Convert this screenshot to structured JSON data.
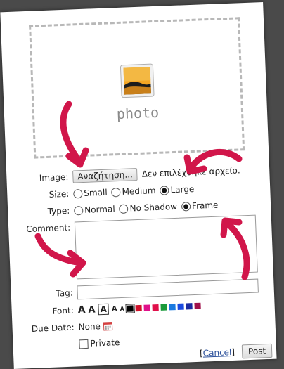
{
  "photo": {
    "placeholder_text": "photo",
    "icon": "photo-icon"
  },
  "image": {
    "label": "Image:",
    "browse_button": "Αναζήτηση...",
    "no_file_text": "Δεν επιλέχθηκε αρχείο."
  },
  "size": {
    "label": "Size:",
    "options": [
      "Small",
      "Medium",
      "Large"
    ],
    "selected": "Large"
  },
  "type": {
    "label": "Type:",
    "options": [
      "Normal",
      "No Shadow",
      "Frame"
    ],
    "selected": "Frame"
  },
  "comment": {
    "label": "Comment:"
  },
  "tag": {
    "label": "Tag:"
  },
  "font": {
    "label": "Font:",
    "sizes": [
      "A",
      "A",
      "A",
      "A",
      "A"
    ],
    "colors": [
      "#000000",
      "#d0102a",
      "#e0108a",
      "#e0104a",
      "#1a9a3a",
      "#1a7ae0",
      "#1a4ae0",
      "#1a2aa0",
      "#a0104a"
    ]
  },
  "due_date": {
    "label": "Due Date:",
    "value": "None",
    "icon": "calendar-icon"
  },
  "private": {
    "label": "Private"
  },
  "actions": {
    "cancel_open": "[",
    "cancel": "Cancel",
    "cancel_close": "]",
    "post": "Post"
  },
  "arrow_color": "#d1164a"
}
